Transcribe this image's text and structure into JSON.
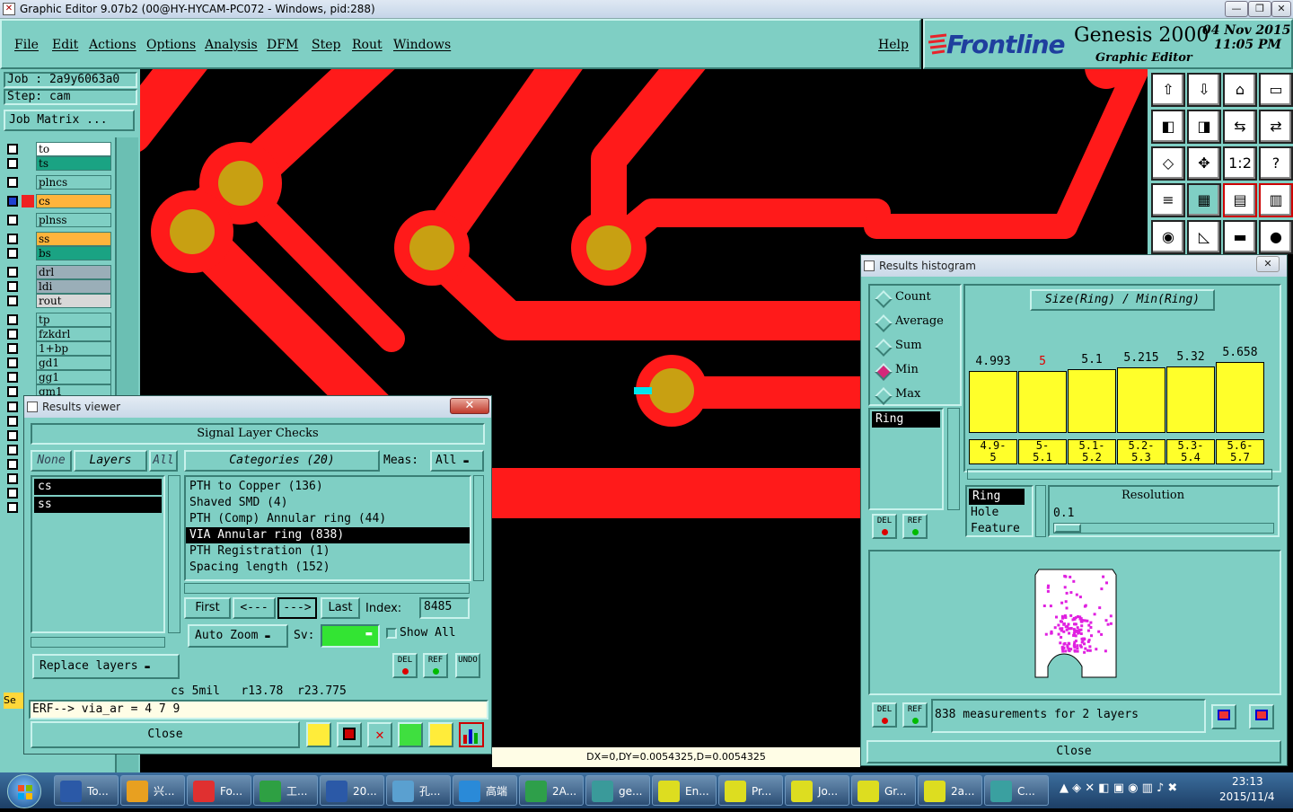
{
  "window": {
    "title": "Graphic Editor 9.07b2 (00@HY-HYCAM-PC072 - Windows, pid:288)"
  },
  "menu": [
    "File",
    "Edit",
    "Actions",
    "Options",
    "Analysis",
    "DFM",
    "Step",
    "Rout",
    "Windows"
  ],
  "help": "Help",
  "brand": {
    "logo": "Frontline",
    "product": "Genesis 2000",
    "subtitle": "Graphic Editor",
    "date": "04 Nov 2015",
    "time": "11:05 PM"
  },
  "job": {
    "job_label": "Job : 2a9y6063a0",
    "step_label": "Step: cam",
    "matrix_button": "Job Matrix ..."
  },
  "layers": [
    {
      "name": "to",
      "color": "#ffffff"
    },
    {
      "name": "ts",
      "color": "#1aa383"
    },
    {
      "name": "plncs",
      "color": "#7fcfc4"
    },
    {
      "name": "cs",
      "color": "#ffb43c"
    },
    {
      "name": "plnss",
      "color": "#7fcfc4"
    },
    {
      "name": "ss",
      "color": "#ffb43c"
    },
    {
      "name": "bs",
      "color": "#1aa383"
    },
    {
      "name": "drl",
      "color": "#9aaeb8"
    },
    {
      "name": "ldi",
      "color": "#9aaeb8"
    },
    {
      "name": "rout",
      "color": "#d8d8d8"
    },
    {
      "name": "tp",
      "color": "#7fcfc4"
    },
    {
      "name": "fzkdrl",
      "color": "#7fcfc4"
    },
    {
      "name": "1+bp",
      "color": "#7fcfc4"
    },
    {
      "name": "gd1",
      "color": "#7fcfc4"
    },
    {
      "name": "gg1",
      "color": "#7fcfc4"
    },
    {
      "name": "gm1",
      "color": "#7fcfc4"
    }
  ],
  "results_viewer": {
    "title": "Results viewer",
    "header": "Signal Layer Checks",
    "none_btn": "None",
    "layers_btn": "Layers",
    "all_btn": "All",
    "categories_btn": "Categories (20)",
    "meas_label": "Meas:",
    "meas_value": "All",
    "layer_list": [
      "cs",
      "ss"
    ],
    "categories": [
      "PTH to Copper (136)",
      "Shaved SMD (4)",
      "PTH (Comp) Annular ring (44)",
      "VIA Annular ring (838)",
      "PTH Registration (1)",
      "Spacing length (152)"
    ],
    "selected_category": 3,
    "first": "First",
    "prev": "<---",
    "next": "--->",
    "last": "Last",
    "index_label": "Index:",
    "index_value": "8485",
    "auto_zoom": "Auto Zoom",
    "sv_label": "Sv:",
    "show_all": "Show All",
    "replace_layers": "Replace layers",
    "info": "cs 5mil   r13.78  r23.775",
    "erf": "ERF--> via_ar = 4 7 9",
    "close": "Close",
    "del": "DEL",
    "ref": "REF",
    "undo": "UNDO"
  },
  "histogram": {
    "title": "Results histogram",
    "modes": [
      "Count",
      "Average",
      "Sum",
      "Min",
      "Max"
    ],
    "selected_mode": 3,
    "heading": "Size(Ring) / Min(Ring)",
    "list": [
      "Ring"
    ],
    "bars": [
      {
        "value": "4.993",
        "label": "4.9-\n5",
        "v": 4.993
      },
      {
        "value": "5",
        "label": "5-\n5.1",
        "v": 5.0
      },
      {
        "value": "5.1",
        "label": "5.1-\n5.2",
        "v": 5.1
      },
      {
        "value": "5.215",
        "label": "5.2-\n5.3",
        "v": 5.215
      },
      {
        "value": "5.32",
        "label": "5.3-\n5.4",
        "v": 5.32
      },
      {
        "value": "5.658",
        "label": "5.6-\n5.7",
        "v": 5.658
      }
    ],
    "highlight_value_color": "#e00000",
    "attr_list": [
      "Ring",
      "Hole",
      "Feature"
    ],
    "resolution_label": "Resolution",
    "resolution_value": "0.1",
    "measurements": "838 measurements for 2 layers",
    "close": "Close",
    "del": "DEL",
    "ref": "REF"
  },
  "status": "DX=0,DY=0.0054325,D=0.0054325",
  "partial_label": "Se",
  "taskbar": {
    "items": [
      "To...",
      "兴...",
      "Fo...",
      "工...",
      "20...",
      "孔...",
      "高端",
      "2A...",
      "ge...",
      "En...",
      "Pr...",
      "Jo...",
      "Gr...",
      "2a...",
      "C..."
    ],
    "clock_time": "23:13",
    "clock_date": "2015/11/4"
  },
  "colors": {
    "copper": "#ff1a1a",
    "pad": "#c8a012",
    "panel": "#7fcfc4",
    "via_marker": "#00e5ee"
  }
}
